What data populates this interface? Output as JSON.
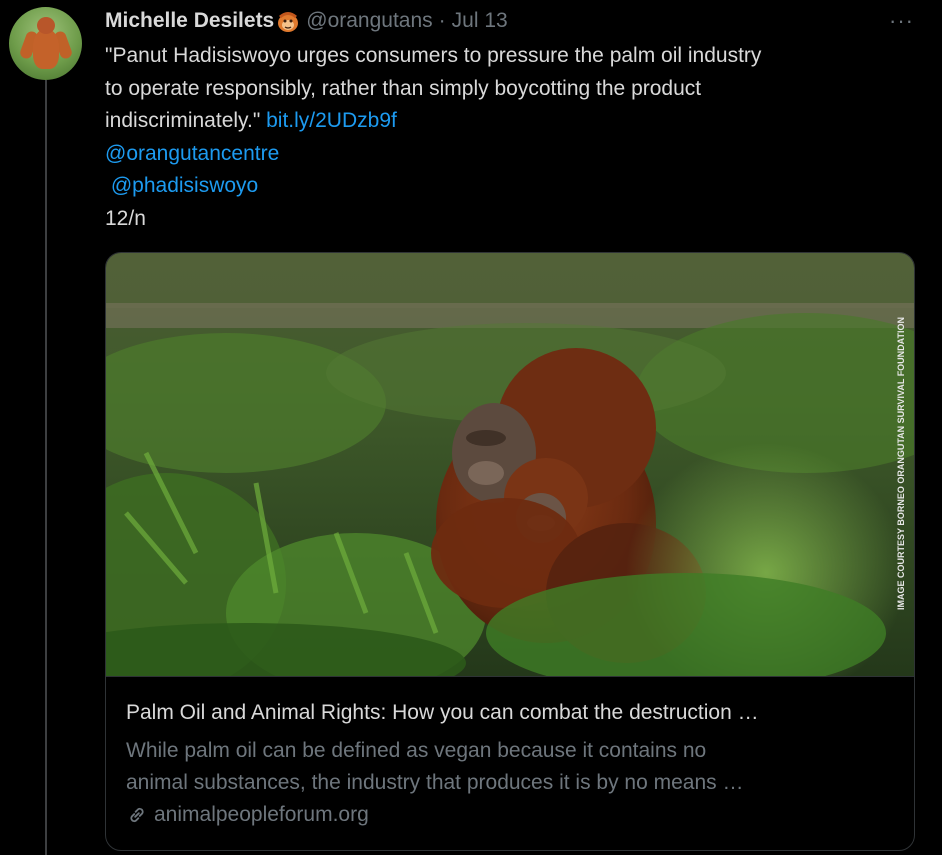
{
  "tweet": {
    "author_name": "Michelle Desilets",
    "author_emoji": "orangutan-emoji-icon",
    "handle": "@orangutans",
    "separator": "·",
    "date": "Jul 13",
    "more_label": "···",
    "text_lines": [
      "\"Panut Hadisiswoyo urges consumers to pressure the palm oil industry",
      "to operate responsibly, rather than simply boycotting the product",
      "indiscriminately.\" "
    ],
    "short_link": "bit.ly/2UDzb9f",
    "mention_1": "@orangutancentre",
    "mention_2": " @phadisiswoyo",
    "thread_count": "12/n"
  },
  "card": {
    "image_credit": "IMAGE COURTESY BORNEO ORANGUTAN SURVIVAL FOUNDATION",
    "title": "Palm Oil and Animal Rights: How you can combat the destruction …",
    "description_lines": [
      "While palm oil can be defined as vegan because it contains no",
      "animal substances, the industry that produces it is by no means …"
    ],
    "domain": "animalpeopleforum.org",
    "domain_icon": "link-icon"
  },
  "colors": {
    "background": "#000000",
    "text": "#d9d9d9",
    "muted": "#6e767d",
    "link": "#1d9bf0",
    "border": "#2f3336"
  }
}
